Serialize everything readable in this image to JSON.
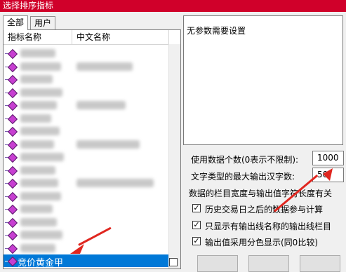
{
  "window": {
    "title": "选择排序指标"
  },
  "tabs": [
    {
      "label": "全部",
      "active": true
    },
    {
      "label": "用户",
      "active": false
    }
  ],
  "list": {
    "columns": [
      "指标名称",
      "中文名称"
    ],
    "selected_item": "竞价黄金甲"
  },
  "info_panel": {
    "text": "无参数需要设置"
  },
  "settings": {
    "data_count_label": "使用数据个数(0表示不限制):",
    "data_count_value": "1000",
    "max_chars_label": "文字类型的最大输出汉字数:",
    "max_chars_value": "50",
    "column_width_label": "数据的栏目宽度与输出值字符长度有关",
    "checkboxes": [
      {
        "label": "历史交易日之后的数据参与计算",
        "checked": true
      },
      {
        "label": "只显示有输出线名称的输出线栏目",
        "checked": true
      },
      {
        "label": "输出值采用分色显示(同0比较)",
        "checked": true
      }
    ]
  },
  "colors": {
    "title_bar": "#d0002a",
    "selection": "#0078d7",
    "annotation_arrow": "#e0261f",
    "item_icon": "#c73fd1"
  }
}
